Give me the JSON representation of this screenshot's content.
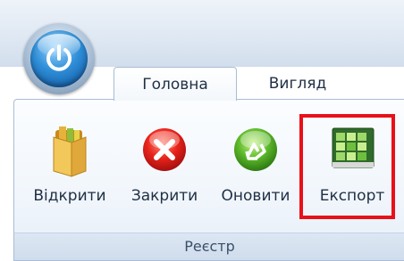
{
  "tabs": [
    {
      "label": "Головна",
      "active": true
    },
    {
      "label": "Вигляд",
      "active": false
    }
  ],
  "buttons": [
    {
      "label": "Відкрити",
      "icon": "folder-icon"
    },
    {
      "label": "Закрити",
      "icon": "close-icon"
    },
    {
      "label": "Оновити",
      "icon": "refresh-icon"
    },
    {
      "label": "Експорт",
      "icon": "export-spreadsheet-icon"
    }
  ],
  "group": {
    "label": "Реєстр"
  },
  "colors": {
    "highlight": "#e8111a",
    "accent": "#2f8fd8"
  }
}
